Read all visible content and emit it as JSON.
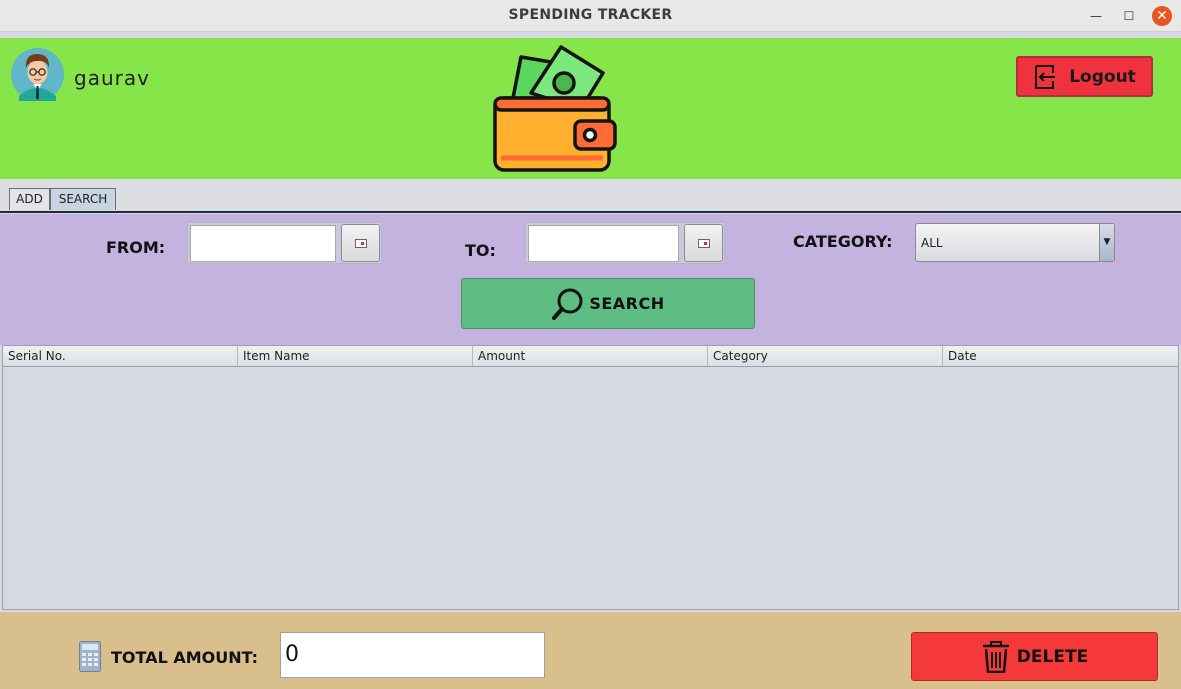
{
  "window": {
    "title": "SPENDING TRACKER",
    "minimize_glyph": "—",
    "maximize_glyph": "☐",
    "close_glyph": "✕"
  },
  "header": {
    "username": "gaurav",
    "avatar_icon": "user-avatar-icon",
    "wallet_icon": "wallet-icon",
    "logout_label": "Logout",
    "logout_icon": "exit-icon",
    "colors": {
      "background": "#86e548",
      "logout": "#f0323f"
    }
  },
  "tabs": [
    {
      "label": "ADD",
      "selected": false
    },
    {
      "label": "SEARCH",
      "selected": true
    }
  ],
  "search": {
    "from_label": "FROM:",
    "from_value": "",
    "to_label": "TO:",
    "to_value": "",
    "category_label": "CATEGORY:",
    "category_value": "ALL",
    "button_label": "SEARCH",
    "colors": {
      "panel": "#c4b3df",
      "button": "#5dbd82"
    }
  },
  "table": {
    "columns": [
      "Serial No.",
      "Item Name",
      "Amount",
      "Category",
      "Date"
    ],
    "rows": []
  },
  "footer": {
    "total_label": "TOTAL AMOUNT:",
    "total_value": "0",
    "delete_label": "DELETE",
    "colors": {
      "background": "#d8bf8c",
      "delete": "#f53838"
    }
  }
}
